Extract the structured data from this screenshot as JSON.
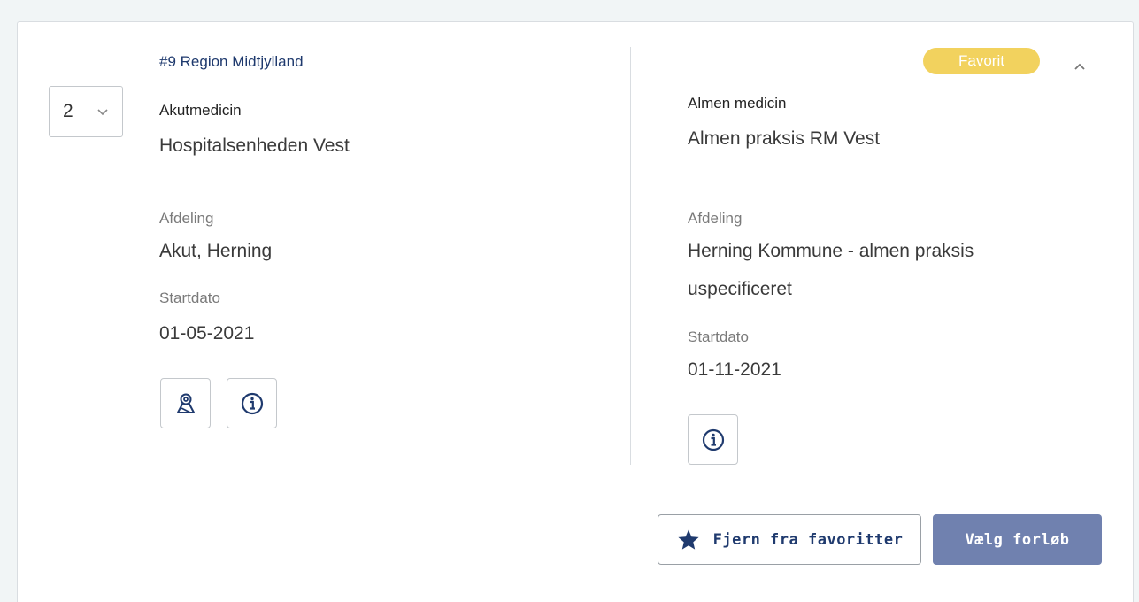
{
  "rank_select": {
    "value": "2"
  },
  "region": "#9 Region Midtjylland",
  "left": {
    "specialty": "Akutmedicin",
    "hospital": "Hospitalsenheden Vest",
    "dept_label": "Afdeling",
    "dept_value": "Akut, Herning",
    "start_label": "Startdato",
    "start_value": "01-05-2021",
    "icons": [
      "map-pin-icon",
      "info-icon"
    ]
  },
  "right": {
    "badge": "Favorit",
    "specialty": "Almen medicin",
    "hospital": "Almen praksis RM Vest",
    "dept_label": "Afdeling",
    "dept_value_line1": "Herning Kommune - almen praksis",
    "dept_value_line2": "uspecificeret",
    "start_label": "Startdato",
    "start_value": "01-11-2021",
    "icons": [
      "info-icon"
    ]
  },
  "actions": {
    "remove_favorite": "Fjern fra favoritter",
    "choose": "Vælg forløb"
  },
  "colors": {
    "brand_navy": "#1f3a6e",
    "badge_yellow": "#f2d25e",
    "primary_button": "#7081af"
  }
}
